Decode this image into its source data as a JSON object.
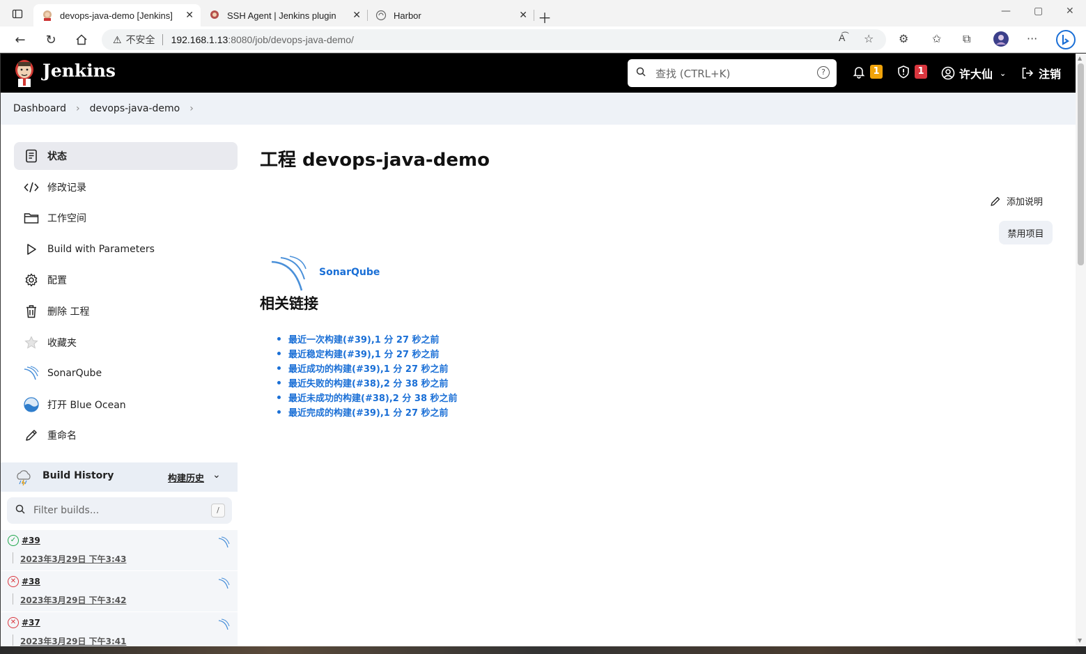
{
  "browser": {
    "tabs": [
      {
        "title": "devops-java-demo [Jenkins]",
        "active": true
      },
      {
        "title": "SSH Agent | Jenkins plugin",
        "active": false
      },
      {
        "title": "Harbor",
        "active": false
      }
    ],
    "url": {
      "security_label": "不安全",
      "host": "192.168.1.13",
      "path": ":8080/job/devops-java-demo/"
    }
  },
  "header": {
    "brand": "Jenkins",
    "search_placeholder": "查找 (CTRL+K)",
    "notifications_count": "1",
    "security_count": "1",
    "user_name": "许大仙",
    "logout_label": "注销",
    "colors": {
      "notify_badge": "#f0a30a",
      "security_badge": "#d9363e"
    }
  },
  "breadcrumb": {
    "items": [
      "Dashboard",
      "devops-java-demo"
    ]
  },
  "sidebar": {
    "items": [
      {
        "label": "状态",
        "icon": "document-icon",
        "active": true
      },
      {
        "label": "修改记录",
        "icon": "code-icon"
      },
      {
        "label": "工作空间",
        "icon": "folder-icon"
      },
      {
        "label": "Build with Parameters",
        "icon": "play-icon"
      },
      {
        "label": "配置",
        "icon": "gear-icon"
      },
      {
        "label": "删除 工程",
        "icon": "trash-icon"
      },
      {
        "label": "收藏夹",
        "icon": "star-icon"
      },
      {
        "label": "SonarQube",
        "icon": "sonarqube-icon"
      },
      {
        "label": "打开 Blue Ocean",
        "icon": "blue-ocean-icon"
      },
      {
        "label": "重命名",
        "icon": "pencil-icon"
      }
    ]
  },
  "build_history": {
    "title": "Build History",
    "trend_label": "构建历史",
    "filter_placeholder": "Filter builds...",
    "filter_shortcut": "/",
    "builds": [
      {
        "number": "#39",
        "date": "2023年3月29日 下午3:43",
        "status": "success"
      },
      {
        "number": "#38",
        "date": "2023年3月29日 下午3:42",
        "status": "failed"
      },
      {
        "number": "#37",
        "date": "2023年3月29日 下午3:41",
        "status": "failed"
      }
    ],
    "colors": {
      "success": "#1ea64b",
      "failed": "#d9363e"
    }
  },
  "main": {
    "title": "工程 devops-java-demo",
    "add_description": "添加说明",
    "disable_project": "禁用项目",
    "sonarqube_label": "SonarQube",
    "related_links_title": "相关链接",
    "permalinks": [
      "最近一次构建(#39),1 分 27 秒之前",
      "最近稳定构建(#39),1 分 27 秒之前",
      "最近成功的构建(#39),1 分 27 秒之前",
      "最近失败的构建(#38),2 分 38 秒之前",
      "最近未成功的构建(#38),2 分 38 秒之前",
      "最近完成的构建(#39),1 分 27 秒之前"
    ],
    "link_color": "#1a6fd6"
  }
}
